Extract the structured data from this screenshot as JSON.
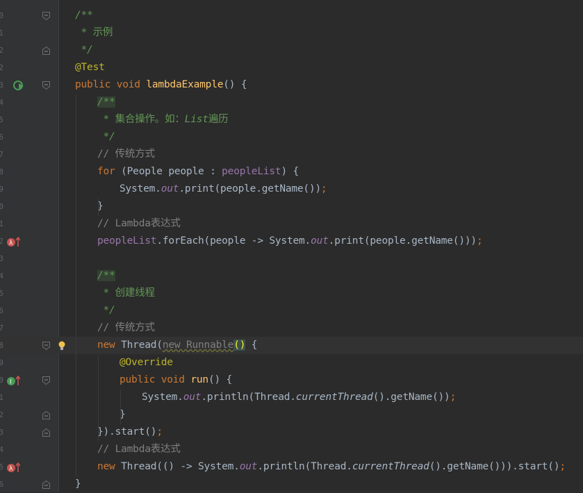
{
  "editor": {
    "lines": [
      {
        "num": "0",
        "parts": [
          {
            "t": "/**",
            "c": "doc"
          }
        ]
      },
      {
        "num": "1",
        "parts": [
          {
            "t": " * ",
            "c": "doc"
          },
          {
            "t": "示例",
            "c": "doccn"
          }
        ]
      },
      {
        "num": "2",
        "parts": [
          {
            "t": " */",
            "c": "doc"
          }
        ]
      },
      {
        "num": "2",
        "parts": [
          {
            "t": "@Test",
            "c": "ann"
          }
        ]
      },
      {
        "num": "3",
        "parts": [
          {
            "t": "public ",
            "c": "kw"
          },
          {
            "t": "void ",
            "c": "kw"
          },
          {
            "t": "lambdaExample",
            "c": "fn"
          },
          {
            "t": "() {",
            "c": ""
          }
        ]
      },
      {
        "num": "4",
        "parts": [
          {
            "t": "/**",
            "c": "doc doc-hl"
          }
        ]
      },
      {
        "num": "5",
        "parts": [
          {
            "t": " * ",
            "c": "doc"
          },
          {
            "t": "集合操作。如：",
            "c": "doccn"
          },
          {
            "t": "List",
            "c": "doclink"
          },
          {
            "t": "遍历",
            "c": "doccn"
          }
        ]
      },
      {
        "num": "6",
        "parts": [
          {
            "t": " */",
            "c": "doc"
          }
        ]
      },
      {
        "num": "7",
        "parts": [
          {
            "t": "// 传统方式",
            "c": "cmt"
          }
        ]
      },
      {
        "num": "8",
        "parts": [
          {
            "t": "for ",
            "c": "kw"
          },
          {
            "t": "(People people : ",
            "c": ""
          },
          {
            "t": "peopleList",
            "c": "fld"
          },
          {
            "t": ") {",
            "c": ""
          }
        ]
      },
      {
        "num": "9",
        "parts": [
          {
            "t": "System.",
            "c": ""
          },
          {
            "t": "out",
            "c": "st"
          },
          {
            "t": ".print(people.getName())",
            "c": ""
          },
          {
            "t": ";",
            "c": "semi"
          }
        ]
      },
      {
        "num": "0",
        "parts": [
          {
            "t": "}",
            "c": ""
          }
        ]
      },
      {
        "num": "1",
        "parts": [
          {
            "t": "// Lambda表达式",
            "c": "cmt"
          }
        ]
      },
      {
        "num": "2",
        "parts": [
          {
            "t": "peopleList",
            "c": "fld"
          },
          {
            "t": ".forEach(people -> System.",
            "c": ""
          },
          {
            "t": "out",
            "c": "st"
          },
          {
            "t": ".print(people.getName()))",
            "c": ""
          },
          {
            "t": ";",
            "c": "semi"
          }
        ]
      },
      {
        "num": "3",
        "parts": []
      },
      {
        "num": "4",
        "parts": [
          {
            "t": "/**",
            "c": "doc doc-hl"
          }
        ]
      },
      {
        "num": "5",
        "parts": [
          {
            "t": " * ",
            "c": "doc"
          },
          {
            "t": "创建线程",
            "c": "doccn"
          }
        ]
      },
      {
        "num": "6",
        "parts": [
          {
            "t": " */",
            "c": "doc"
          }
        ]
      },
      {
        "num": "7",
        "parts": [
          {
            "t": "// 传统方式",
            "c": "cmt"
          }
        ]
      },
      {
        "num": "8",
        "parts": [
          {
            "t": "new ",
            "c": "kw"
          },
          {
            "t": "Thread(",
            "c": ""
          },
          {
            "t": "new Runnable",
            "c": "unused"
          },
          {
            "t": "()",
            "c": "paren-hl"
          },
          {
            "t": " {",
            "c": ""
          }
        ]
      },
      {
        "num": "9",
        "parts": [
          {
            "t": "@Override",
            "c": "ann"
          }
        ]
      },
      {
        "num": "0",
        "parts": [
          {
            "t": "public ",
            "c": "kw"
          },
          {
            "t": "void ",
            "c": "kw"
          },
          {
            "t": "run",
            "c": "fn"
          },
          {
            "t": "() {",
            "c": ""
          }
        ]
      },
      {
        "num": "1",
        "parts": [
          {
            "t": "System.",
            "c": ""
          },
          {
            "t": "out",
            "c": "st"
          },
          {
            "t": ".println(Thread.",
            "c": ""
          },
          {
            "t": "currentThread",
            "c": "stm"
          },
          {
            "t": "().getName())",
            "c": ""
          },
          {
            "t": ";",
            "c": "semi"
          }
        ]
      },
      {
        "num": "2",
        "parts": [
          {
            "t": "}",
            "c": ""
          }
        ]
      },
      {
        "num": "3",
        "parts": [
          {
            "t": "}).start()",
            "c": ""
          },
          {
            "t": ";",
            "c": "semi"
          }
        ]
      },
      {
        "num": "4",
        "parts": [
          {
            "t": "// Lambda表达式",
            "c": "cmt"
          }
        ]
      },
      {
        "num": "5",
        "parts": [
          {
            "t": "new ",
            "c": "kw"
          },
          {
            "t": "Thread(() -> System.",
            "c": ""
          },
          {
            "t": "out",
            "c": "st"
          },
          {
            "t": ".println(Thread.",
            "c": ""
          },
          {
            "t": "currentThread",
            "c": "stm"
          },
          {
            "t": "().getName())).start()",
            "c": ""
          },
          {
            "t": ";",
            "c": "semi"
          }
        ]
      },
      {
        "num": "6",
        "parts": [
          {
            "t": "}",
            "c": ""
          }
        ]
      }
    ]
  },
  "colors": {
    "background": "#2b2b2b",
    "gutter": "#313335",
    "keyword": "#cc7832",
    "javadoc": "#629755",
    "annotation": "#bbb529",
    "method": "#ffc66d",
    "field": "#9876aa",
    "comment": "#808080",
    "text": "#a9b7c6"
  },
  "icons": {
    "run": "run-test-icon",
    "lambda": "lambda-implements-icon",
    "override": "implements-method-icon",
    "bulb": "intention-bulb-icon",
    "fold": "fold-marker-icon"
  }
}
